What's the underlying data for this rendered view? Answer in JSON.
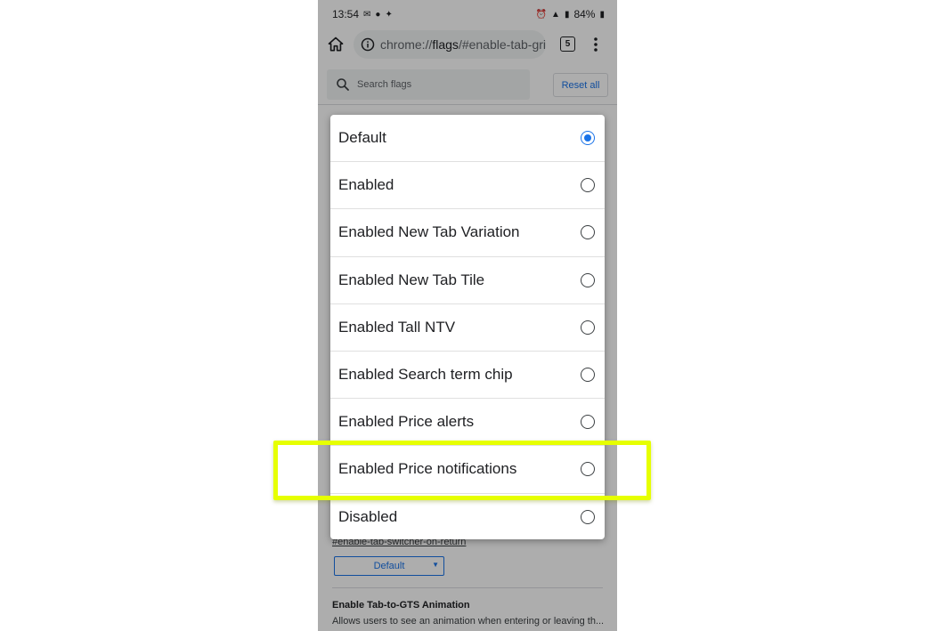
{
  "status_bar": {
    "time": "13:54",
    "battery": "84%"
  },
  "browser": {
    "url_prefix": "chrome://",
    "url_host": "flags",
    "url_rest": "/#enable-tab-grid",
    "tab_count": "5"
  },
  "flags_page": {
    "search_placeholder": "Search flags",
    "reset_label": "Reset all",
    "flag_link": "#enable-tab-switcher-on-return",
    "select_value": "Default",
    "next_flag_title": "Enable Tab-to-GTS Animation",
    "next_flag_desc": "Allows users to see an animation when entering or leaving th..."
  },
  "dialog": {
    "options": [
      {
        "label": "Default",
        "selected": true
      },
      {
        "label": "Enabled",
        "selected": false
      },
      {
        "label": "Enabled New Tab Variation",
        "selected": false
      },
      {
        "label": "Enabled New Tab Tile",
        "selected": false
      },
      {
        "label": "Enabled Tall NTV",
        "selected": false
      },
      {
        "label": "Enabled Search term chip",
        "selected": false
      },
      {
        "label": "Enabled Price alerts",
        "selected": false
      },
      {
        "label": "Enabled Price notifications",
        "selected": false
      },
      {
        "label": "Disabled",
        "selected": false
      }
    ]
  },
  "colors": {
    "accent": "#1a73e8",
    "highlight": "#e6ff00"
  }
}
